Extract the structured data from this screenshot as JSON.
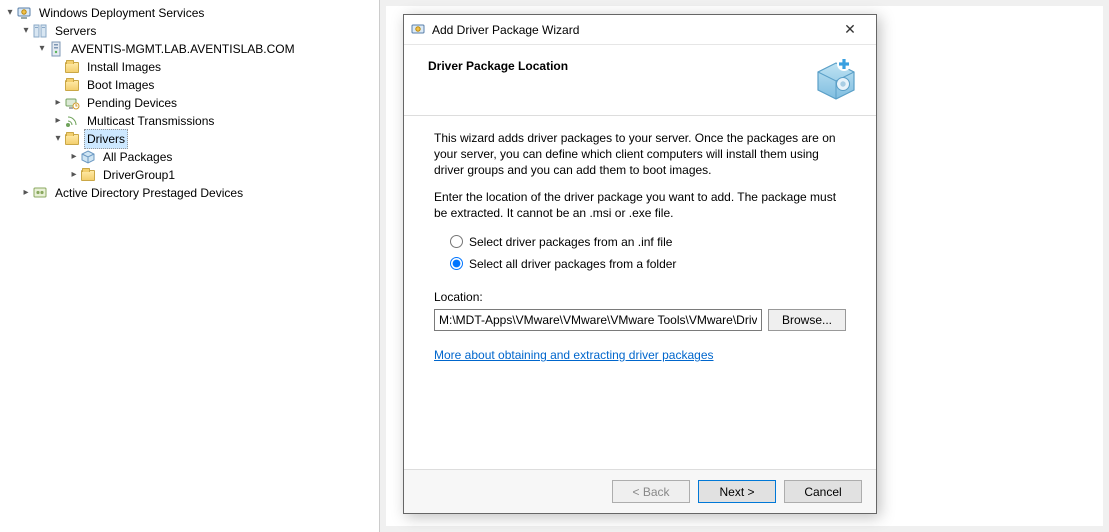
{
  "tree": {
    "root": "Windows Deployment Services",
    "servers": "Servers",
    "server_fqdn": "AVENTIS-MGMT.LAB.AVENTISLAB.COM",
    "install_images": "Install Images",
    "boot_images": "Boot Images",
    "pending_devices": "Pending Devices",
    "multicast": "Multicast Transmissions",
    "drivers": "Drivers",
    "all_packages": "All Packages",
    "driver_group1": "DriverGroup1",
    "ad_prestaged": "Active Directory Prestaged Devices"
  },
  "dialog": {
    "title": "Add Driver Package Wizard",
    "heading": "Driver Package Location",
    "intro": "This wizard adds driver packages to your server. Once the packages are on your server, you can define which client computers will install them using driver groups and you can add them to boot images.",
    "enter_loc": "Enter the location of the driver package you want to add. The package must be extracted. It cannot be an .msi or .exe file.",
    "radio_inf": "Select driver packages from an .inf file",
    "radio_folder": "Select all driver packages from a folder",
    "location_label": "Location:",
    "location_value": "M:\\MDT-Apps\\VMware\\VMware\\VMware Tools\\VMware\\Drivers",
    "browse": "Browse...",
    "more_link": "More about obtaining and extracting driver packages",
    "back": "< Back",
    "next": "Next >",
    "cancel": "Cancel"
  }
}
